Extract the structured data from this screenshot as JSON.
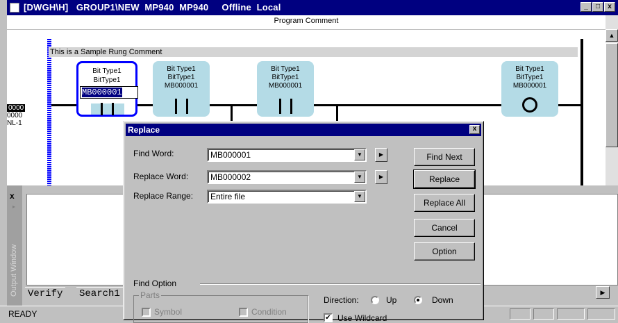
{
  "window": {
    "title": "[DWGH\\H]   GROUP1\\NEW  MP940  MP940     Offline  Local",
    "min": "_",
    "max": "□",
    "close": "x"
  },
  "ladder": {
    "program_comment": "Program Comment",
    "rung_comment": "This is a Sample Rung Comment",
    "rung_number": "0000",
    "rung_step": "0000",
    "rung_label": "NL-1",
    "elements": [
      {
        "line1": "Bit Type1",
        "line2": "BitType1",
        "addr": "MB000001"
      },
      {
        "line1": "Bit Type1",
        "line2": "BitType1",
        "addr": "MB000001"
      },
      {
        "line1": "Bit Type1",
        "line2": "BitType1",
        "addr": "MB000001"
      },
      {
        "line1": "Bit Type1",
        "line2": "BitType1",
        "addr": "MB000001"
      }
    ]
  },
  "output": {
    "close": "x",
    "vertical_label": "Output Window",
    "tabs": [
      "Verify",
      "Search1"
    ]
  },
  "status": {
    "ready": "READY"
  },
  "dialog": {
    "title": "Replace",
    "close": "x",
    "find_word_label": "Find Word:",
    "find_word_value": "MB000001",
    "replace_word_label": "Replace Word:",
    "replace_word_value": "MB000002",
    "replace_range_label": "Replace Range:",
    "replace_range_value": "Entire file",
    "buttons": {
      "find_next": "Find Next",
      "replace": "Replace",
      "replace_all": "Replace All",
      "cancel": "Cancel",
      "option": "Option"
    },
    "find_option": "Find Option",
    "parts": "Parts",
    "symbol": "Symbol",
    "condition": "Condition",
    "direction": "Direction:",
    "up": "Up",
    "down": "Down",
    "use_wildcard": "Use Wildcard"
  }
}
